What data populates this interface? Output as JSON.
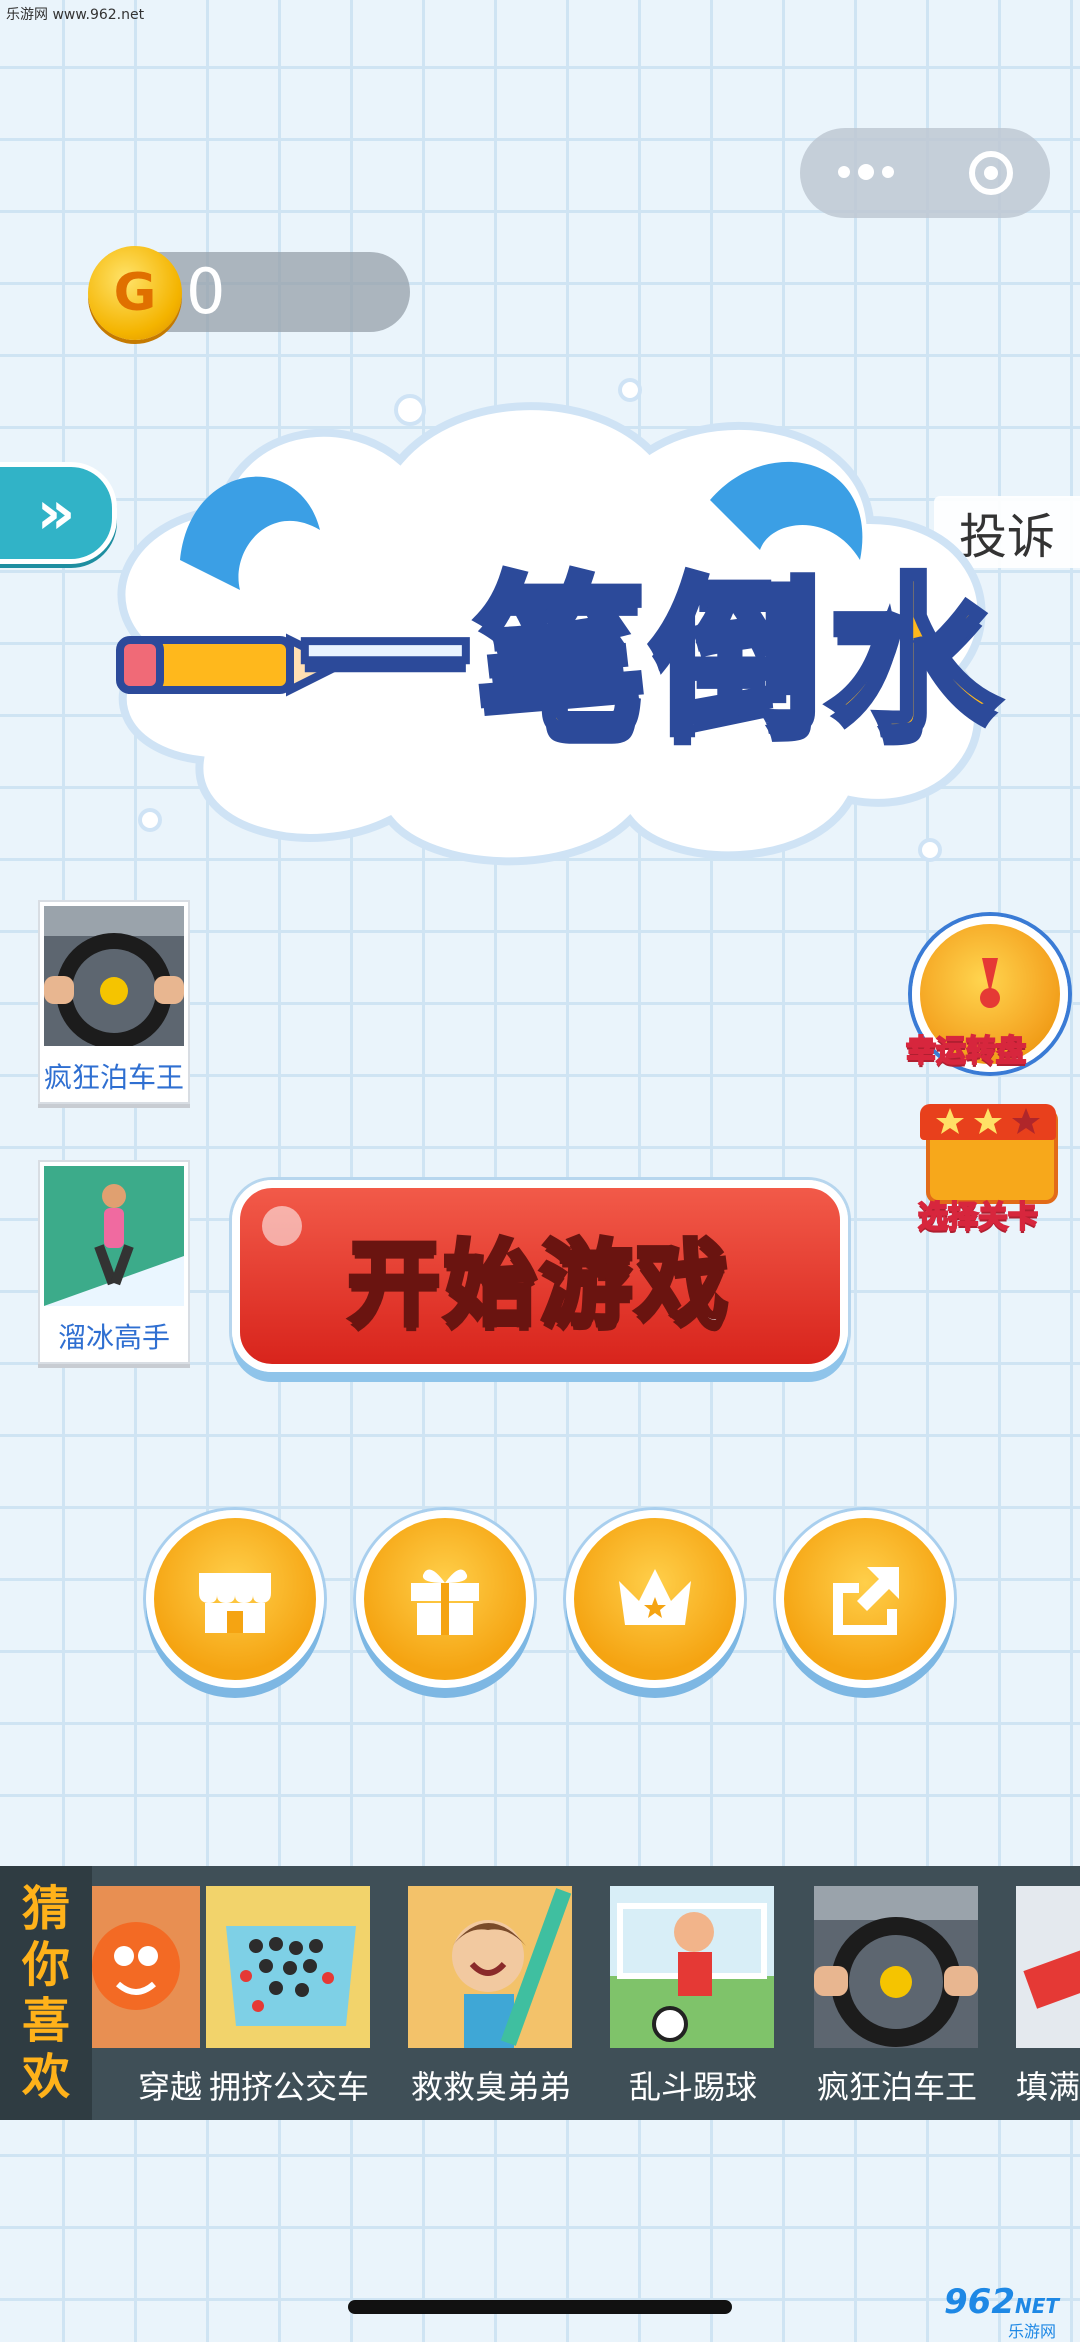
{
  "watermark": {
    "site": "乐游网 www.962.net",
    "logo": "962",
    "logo_suffix": "NET",
    "logo_sub": "乐游网"
  },
  "capsule": {
    "more_icon": "more-dots-icon",
    "close_icon": "target-close-icon"
  },
  "coins": {
    "symbol": "G",
    "value": "0"
  },
  "side_tab": {
    "icon": "double-chevron-right-icon",
    "label": "»"
  },
  "complaint_label": "投诉",
  "title": {
    "first": "一",
    "rest": "笔倒水"
  },
  "left_ads": [
    {
      "label": "疯狂泊车王",
      "icon": "steering-wheel-thumb"
    },
    {
      "label": "溜冰高手",
      "icon": "skater-thumb"
    }
  ],
  "lucky_wheel_label": "幸运转盘",
  "select_level_label": "选择关卡",
  "start_button_label": "开始游戏",
  "round_buttons": [
    {
      "name": "shop-button",
      "icon": "shop-icon"
    },
    {
      "name": "gift-button",
      "icon": "gift-icon"
    },
    {
      "name": "rank-button",
      "icon": "crown-icon"
    },
    {
      "name": "share-button",
      "icon": "share-icon"
    }
  ],
  "recommend": {
    "title_chars": [
      "猜",
      "你",
      "喜",
      "欢"
    ],
    "items": [
      {
        "label": "穿越",
        "color": "#f0a36a"
      },
      {
        "label": "拥挤公交车",
        "color": "#7ed0e6"
      },
      {
        "label": "救救臭弟弟",
        "color": "#f3c26a"
      },
      {
        "label": "乱斗踢球",
        "color": "#7fc36a"
      },
      {
        "label": "疯狂泊车王",
        "color": "#6a6f78"
      },
      {
        "label": "填满",
        "color": "#e4e9ee"
      }
    ]
  },
  "colors": {
    "accent_red": "#d8241c",
    "coin_gold": "#f4b400",
    "strip_bg": "#3f4f57",
    "strip_title": "#ffb21a"
  }
}
